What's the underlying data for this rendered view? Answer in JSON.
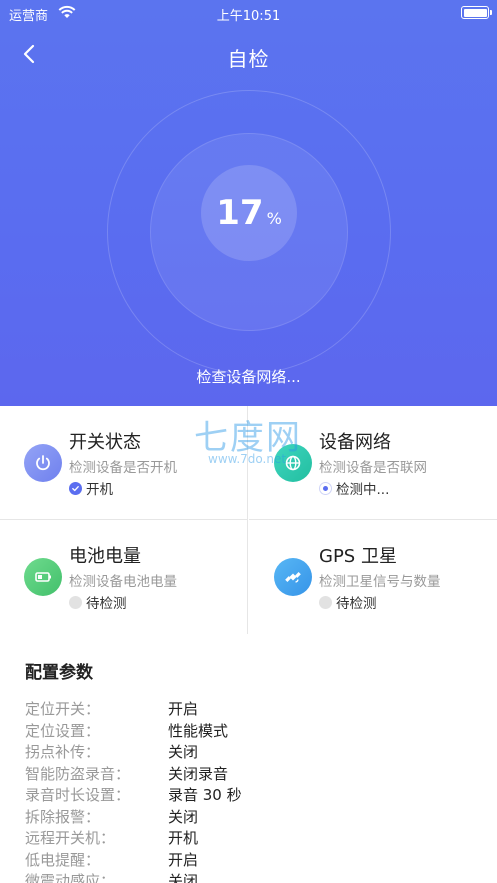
{
  "status_bar": {
    "carrier": "运营商",
    "time": "上午10:51"
  },
  "header": {
    "title": "自检"
  },
  "progress": {
    "value": "17",
    "unit": "%",
    "message": "检查设备网络..."
  },
  "checks": [
    {
      "title": "开关状态",
      "desc": "检测设备是否开机",
      "state": "开机",
      "state_type": "done",
      "icon": "power-icon"
    },
    {
      "title": "设备网络",
      "desc": "检测设备是否联网",
      "state": "检测中...",
      "state_type": "running",
      "icon": "globe-icon"
    },
    {
      "title": "电池电量",
      "desc": "检测设备电池电量",
      "state": "待检测",
      "state_type": "waiting",
      "icon": "battery-icon"
    },
    {
      "title": "GPS 卫星",
      "desc": "检测卫星信号与数量",
      "state": "待检测",
      "state_type": "waiting",
      "icon": "satellite-icon"
    }
  ],
  "watermark": {
    "logo": "七度网",
    "url": "www.7do.net"
  },
  "config": {
    "title": "配置参数",
    "rows": [
      {
        "key": "定位开关：",
        "value": "开启"
      },
      {
        "key": "定位设置：",
        "value": "性能模式"
      },
      {
        "key": "拐点补传：",
        "value": "关闭"
      },
      {
        "key": "智能防盗录音：",
        "value": "关闭录音"
      },
      {
        "key": "录音时长设置：",
        "value": "录音 30 秒"
      },
      {
        "key": "拆除报警：",
        "value": "关闭"
      },
      {
        "key": "远程开关机：",
        "value": "开机"
      },
      {
        "key": "低电提醒：",
        "value": "开启"
      },
      {
        "key": "微震动感应：",
        "value": "关闭"
      }
    ]
  },
  "colors": {
    "primary": "#5b6ef0",
    "text_secondary": "#999999"
  }
}
